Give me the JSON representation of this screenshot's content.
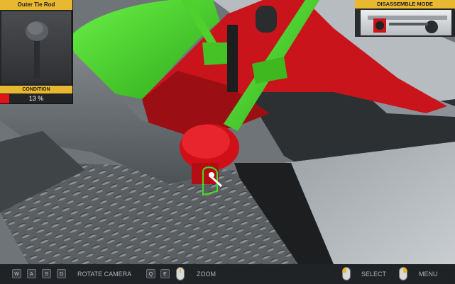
{
  "part_panel": {
    "title": "Outer Tie Rod",
    "condition_label": "CONDITION",
    "condition_value": "13 %",
    "condition_fraction": 0.13,
    "condition_color": "#e0141a"
  },
  "mode_panel": {
    "title": "DISASSEMBLE MODE"
  },
  "controls": {
    "camera_keys": [
      "W",
      "A",
      "S",
      "D"
    ],
    "rotate_label": "ROTATE CAMERA",
    "zoom_keys": [
      "Q",
      "E"
    ],
    "zoom_label": "ZOOM",
    "select_label": "SELECT",
    "menu_label": "MENU"
  },
  "theme": {
    "accent": "#e8b830",
    "part_highlight": "#44dd22",
    "part_selected": "#e0141a"
  }
}
